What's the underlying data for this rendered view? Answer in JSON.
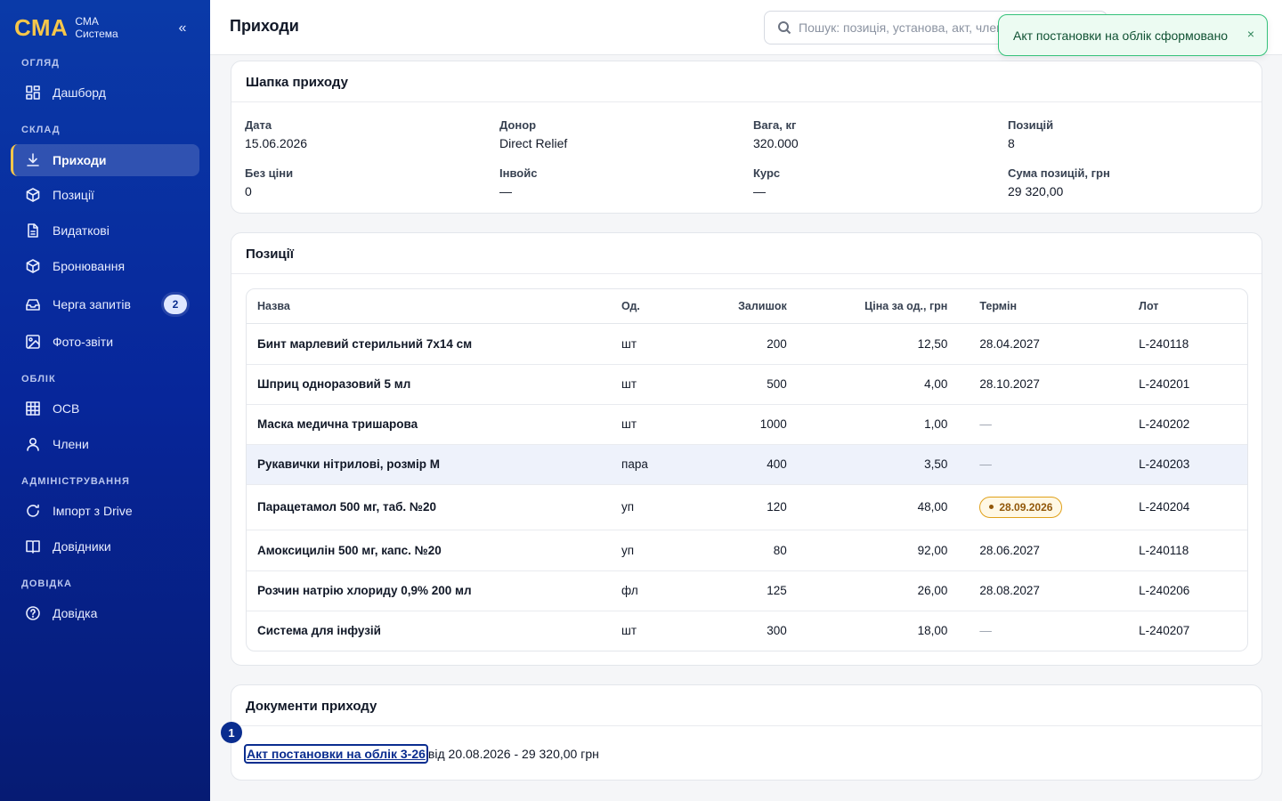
{
  "brand": {
    "logo": "СМА",
    "line1": "СМА",
    "line2": "Система",
    "collapse": "«"
  },
  "sidebar": {
    "sections": {
      "overview": "ОГЛЯД",
      "warehouse": "СКЛАД",
      "accounting": "ОБЛІК",
      "admin": "АДМІНІСТРУВАННЯ",
      "help": "ДОВІДКА"
    },
    "items": {
      "dashboard": "Дашборд",
      "incoming": "Приходи",
      "positions": "Позиції",
      "outgoing": "Видаткові",
      "booking": "Бронювання",
      "queue": "Черга запитів",
      "queue_badge": "2",
      "photos": "Фото-звіти",
      "osv": "ОСВ",
      "members": "Члени",
      "import": "Імпорт з Drive",
      "refs": "Довідники",
      "help": "Довідка"
    }
  },
  "header": {
    "title": "Приходи",
    "search_placeholder": "Пошук: позиція, установа, акт, член…"
  },
  "toast": {
    "message": "Акт постановки на облік сформовано",
    "close": "×"
  },
  "receipt_header": {
    "title": "Шапка приходу",
    "fields": {
      "date_label": "Дата",
      "date": "15.06.2026",
      "donor_label": "Донор",
      "donor": "Direct Relief",
      "weight_label": "Вага, кг",
      "weight": "320.000",
      "positions_label": "Позицій",
      "positions": "8",
      "noprice_label": "Без ціни",
      "noprice": "0",
      "invoice_label": "Інвойс",
      "invoice": "—",
      "rate_label": "Курс",
      "rate": "—",
      "sum_label": "Сума позицій, грн",
      "sum": "29 320,00"
    }
  },
  "positions": {
    "title": "Позиції",
    "columns": [
      "Назва",
      "Од.",
      "Залишок",
      "Ціна за од., грн",
      "Термін",
      "Лот"
    ],
    "rows": [
      {
        "name": "Бинт марлевий стерильний 7х14 см",
        "unit": "шт",
        "qty": "200",
        "price": "12,50",
        "term": "28.04.2027",
        "lot": "L-240118"
      },
      {
        "name": "Шприц одноразовий 5 мл",
        "unit": "шт",
        "qty": "500",
        "price": "4,00",
        "term": "28.10.2027",
        "lot": "L-240201"
      },
      {
        "name": "Маска медична тришарова",
        "unit": "шт",
        "qty": "1000",
        "price": "1,00",
        "term": "—",
        "lot": "L-240202"
      },
      {
        "name": "Рукавички нітрилові, розмір M",
        "unit": "пара",
        "qty": "400",
        "price": "3,50",
        "term": "—",
        "lot": "L-240203"
      },
      {
        "name": "Парацетамол 500 мг, таб. №20",
        "unit": "уп",
        "qty": "120",
        "price": "48,00",
        "term": "28.09.2026",
        "lot": "L-240204"
      },
      {
        "name": "Амоксицилін 500 мг, капс. №20",
        "unit": "уп",
        "qty": "80",
        "price": "92,00",
        "term": "28.06.2027",
        "lot": "L-240118"
      },
      {
        "name": "Розчин натрію хлориду 0,9% 200 мл",
        "unit": "фл",
        "qty": "125",
        "price": "26,00",
        "term": "28.08.2027",
        "lot": "L-240206"
      },
      {
        "name": "Система для інфузій",
        "unit": "шт",
        "qty": "300",
        "price": "18,00",
        "term": "—",
        "lot": "L-240207"
      }
    ]
  },
  "documents": {
    "title": "Документи приходу",
    "link": "Акт постановки на облік 3-26",
    "suffix": "від 20.08.2026 - 29 320,00 грн",
    "marker": "1"
  }
}
